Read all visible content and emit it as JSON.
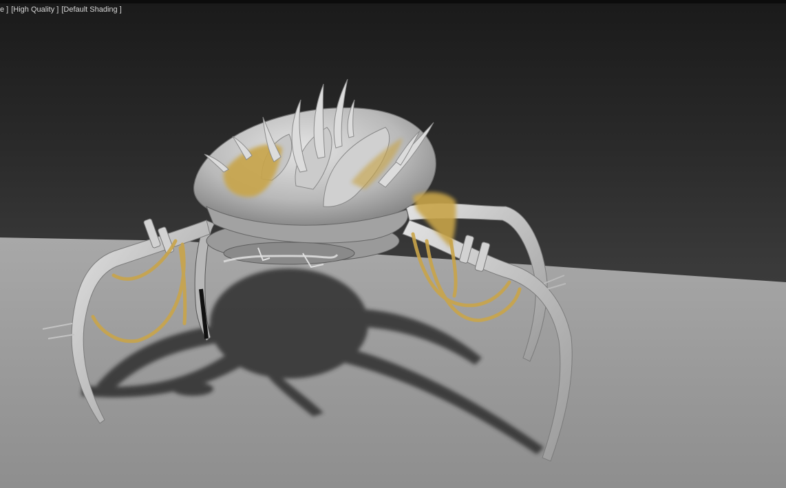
{
  "viewport": {
    "label_segment_1": "e ]",
    "label_segment_2": "[High Quality ]",
    "label_segment_3": "[Default Shading ]"
  },
  "colors": {
    "background_top": "#1a1a1a",
    "background_bottom": "#474747",
    "ground": "#9b9b9b",
    "model": "#c8c8c8",
    "fur": "#c9a54a",
    "shadow": "#303030"
  }
}
